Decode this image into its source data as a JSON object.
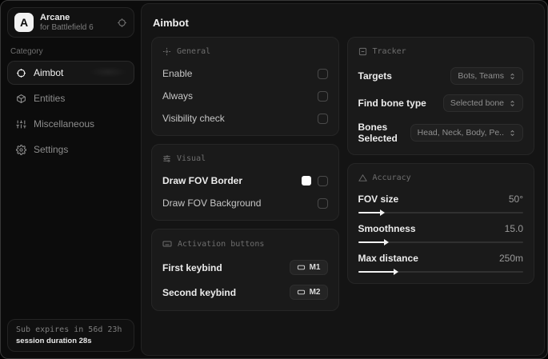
{
  "colors": {
    "accent": "#f2f2f2",
    "fov_border_swatch": "#ffffff"
  },
  "sidebar": {
    "app": {
      "initial": "A",
      "name": "Arcane",
      "subtitle": "for Battlefield 6"
    },
    "category_label": "Category",
    "items": [
      {
        "label": "Aimbot",
        "icon": "crosshair-icon",
        "active": true
      },
      {
        "label": "Entities",
        "icon": "cube-icon",
        "active": false
      },
      {
        "label": "Miscellaneous",
        "icon": "sliders-icon",
        "active": false
      },
      {
        "label": "Settings",
        "icon": "gear-icon",
        "active": false
      }
    ],
    "footer": {
      "line1": "Sub expires in 56d 23h",
      "line2": "session duration 28s"
    }
  },
  "main": {
    "title": "Aimbot",
    "general": {
      "title": "General",
      "rows": [
        {
          "label": "Enable",
          "checked": false
        },
        {
          "label": "Always",
          "checked": false
        },
        {
          "label": "Visibility check",
          "checked": false
        }
      ]
    },
    "visual": {
      "title": "Visual",
      "rows": [
        {
          "label": "Draw FOV Border",
          "checked": false,
          "swatch": "#ffffff"
        },
        {
          "label": "Draw FOV Background",
          "checked": false
        }
      ]
    },
    "activation": {
      "title": "Activation buttons",
      "rows": [
        {
          "label": "First keybind",
          "key": "M1"
        },
        {
          "label": "Second keybind",
          "key": "M2"
        }
      ]
    },
    "tracker": {
      "title": "Tracker",
      "rows": [
        {
          "label": "Targets",
          "value": "Bots, Teams"
        },
        {
          "label": "Find bone type",
          "value": "Selected bone"
        },
        {
          "label": "Bones Selected",
          "value": "Head, Neck, Body, Pe.."
        }
      ]
    },
    "accuracy": {
      "title": "Accuracy",
      "sliders": [
        {
          "label": "FOV size",
          "value": "50°",
          "percent": 14
        },
        {
          "label": "Smoothness",
          "value": "15.0",
          "percent": 16
        },
        {
          "label": "Max distance",
          "value": "250m",
          "percent": 22
        }
      ]
    }
  }
}
